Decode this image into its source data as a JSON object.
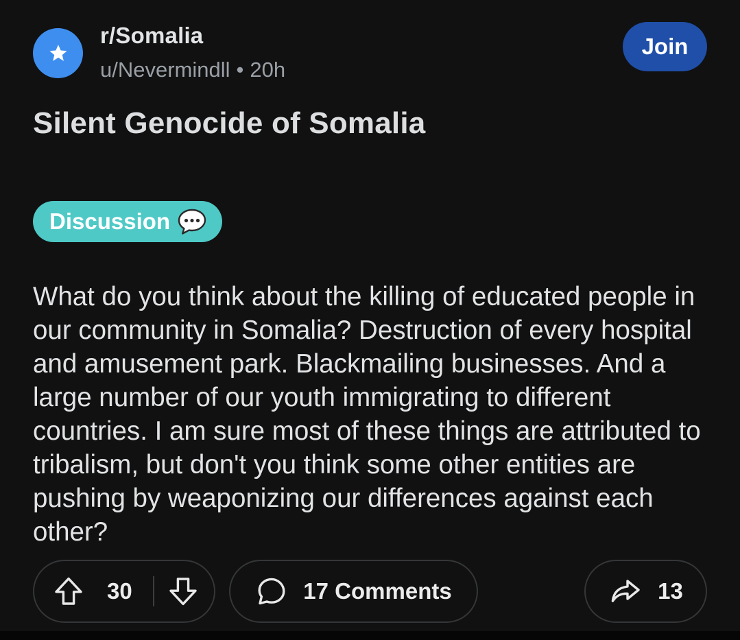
{
  "header": {
    "subreddit": "r/Somalia",
    "author": "u/Nevermindll",
    "separator": "•",
    "age": "20h",
    "join_label": "Join",
    "avatar_icon": "star-icon",
    "avatar_color": "#3e8ef0",
    "join_color": "#1f4fa8"
  },
  "post": {
    "title": "Silent Genocide of Somalia",
    "flair": {
      "label": "Discussion",
      "icon": "speech-balloon-icon",
      "color": "#4ec9c6"
    },
    "body": "What do you think about the killing of educated people in our community in Somalia? Destruction of every hospital and amusement park. Blackmailing businesses. And a large number of our youth immigrating to different countries. I am sure most of these things are attributed to tribalism, but don't you think some other entities are pushing by weaponizing our differences against each other?"
  },
  "actions": {
    "score": "30",
    "comments_label": "17 Comments",
    "shares": "13",
    "upvote_icon": "upvote-arrow-icon",
    "downvote_icon": "downvote-arrow-icon",
    "comment_icon": "comment-bubble-icon",
    "share_icon": "share-arrow-icon"
  }
}
